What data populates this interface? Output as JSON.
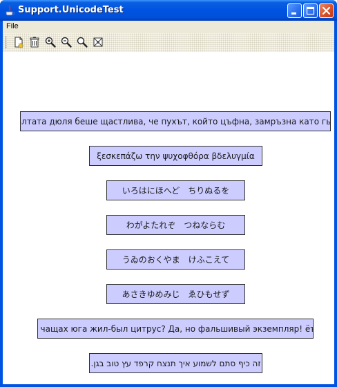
{
  "window": {
    "title": "Support.UnicodeTest",
    "icon": "java-icon",
    "controls": [
      "minimize-icon",
      "maximize-icon",
      "close-icon"
    ]
  },
  "menu": {
    "file_label": "File"
  },
  "toolbar": {
    "tools": [
      "new-document-icon",
      "delete-icon",
      "zoom-in-icon",
      "zoom-out-icon",
      "zoom-reset-icon",
      "fit-page-icon"
    ]
  },
  "samples": [
    "Жълтата дюля беше щастлива, че пухът, който цъфна, замръзна като гьон.",
    "ξεσκεπάζω την ψυχοφθόρα βδελυγμία",
    "いろはにほへど　ちりぬるを",
    "わがよたれぞ　つねならむ",
    "うゐのおくやま　けふこえて",
    "あさきゆめみじ　ゑひもせず",
    "В чащах юга жил-был цитрус? Да, но фальшивый экземпляр! ёъ.",
    "זה כיף סתם לשמוע איך תנצח קרפד עץ טוב בגן."
  ],
  "colors": {
    "sample_bg": "#ccccff",
    "titlebar": "#0054e3",
    "close": "#d9502a"
  }
}
